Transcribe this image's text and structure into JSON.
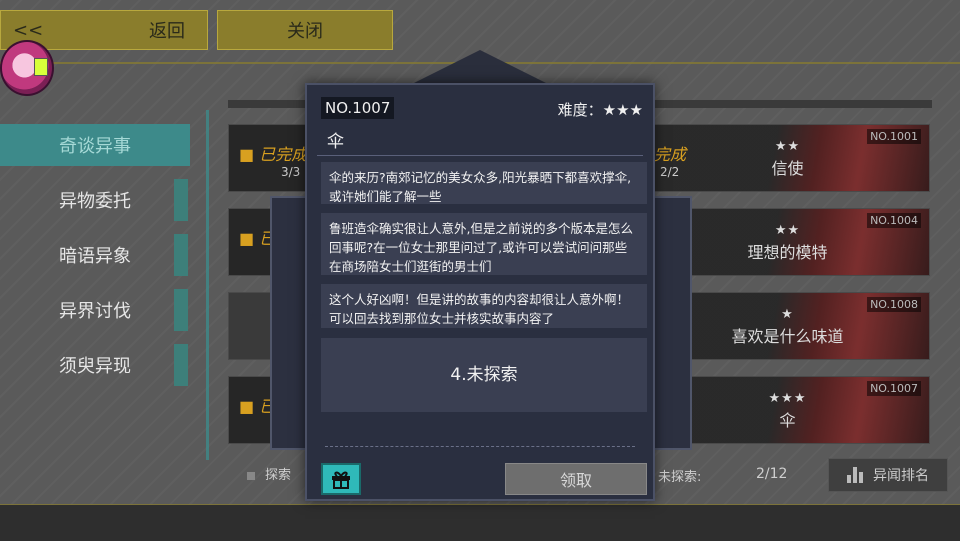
{
  "topbar": {
    "back_arrow": "<<",
    "back_label": "返回",
    "close_label": "关闭"
  },
  "sidebar": {
    "items": [
      {
        "label": "奇谈异事",
        "active": true
      },
      {
        "label": "异物委托",
        "active": false
      },
      {
        "label": "暗语异象",
        "active": false
      },
      {
        "label": "异界讨伐",
        "active": false
      },
      {
        "label": "须臾异现",
        "active": false
      }
    ]
  },
  "left_cards": [
    {
      "status": "■ 已完成",
      "count": "3/3"
    },
    {
      "status": "■ 已",
      "count": ""
    },
    {
      "status": "",
      "count": ""
    },
    {
      "status": "■ 已",
      "count": ""
    }
  ],
  "right_cards": [
    {
      "no": "NO.1001",
      "stars": "★★",
      "title": "信使",
      "status": "完成",
      "count": "2/2"
    },
    {
      "no": "NO.1004",
      "stars": "★★",
      "title": "理想的模特",
      "status": "",
      "count": ""
    },
    {
      "no": "NO.1008",
      "stars": "★",
      "title": "喜欢是什么味道",
      "status": "",
      "count": ""
    },
    {
      "no": "NO.1007",
      "stars": "★★★",
      "title": "伞",
      "status": "",
      "count": ""
    }
  ],
  "footer": {
    "explore_label": "探索",
    "unexplored_label": "未探索:",
    "unexplored_value": "2/12",
    "rank_label": "异闻排名"
  },
  "modal": {
    "no": "NO.1007",
    "difficulty": "难度：★★★",
    "name": "伞",
    "clues": [
      "伞的来历?南郊记忆的美女众多,阳光暴晒下都喜欢撑伞,或许她们能了解一些",
      "鲁班造伞确实很让人意外,但是之前说的多个版本是怎么回事呢?在一位女士那里问过了,或许可以尝试问问那些在商场陪女士们逛街的男士们",
      "这个人好凶啊！但是讲的故事的内容却很让人意外啊！可以回去找到那位女士并核实故事内容了",
      "4.未探索"
    ],
    "claim_label": "领取"
  },
  "colors": {
    "accent_teal": "#3d8a8a",
    "gold": "#8a7d2c",
    "completed": "#d8a020"
  }
}
